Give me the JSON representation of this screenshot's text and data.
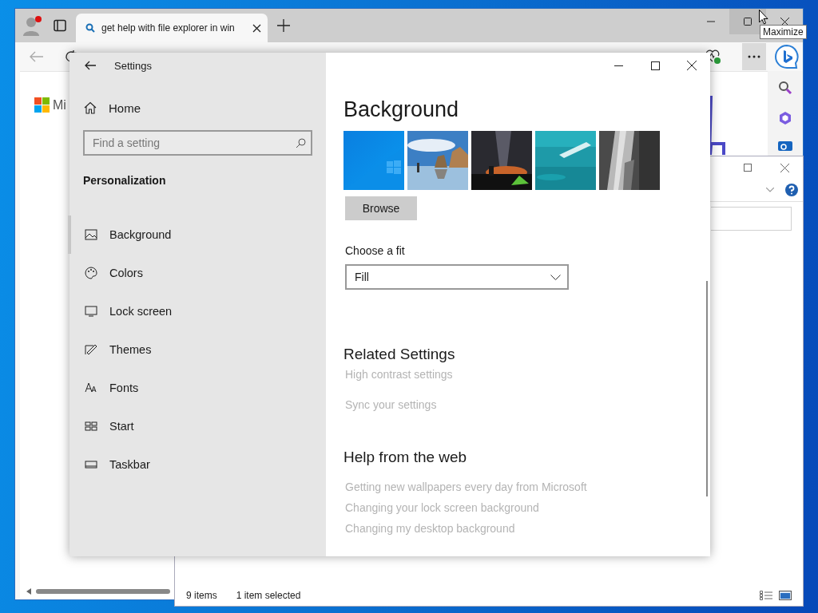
{
  "browser": {
    "tab": {
      "title": "get help with file explorer in win"
    },
    "tooltip": "Maximize",
    "page": {
      "logo_text": "Mi"
    }
  },
  "explorer": {
    "status_bar": {
      "item_count": "9 items",
      "selection": "1 item selected"
    }
  },
  "settings": {
    "title": "Settings",
    "nav": {
      "home": "Home",
      "search_placeholder": "Find a setting",
      "section": "Personalization",
      "items": [
        {
          "label": "Background",
          "selected": true
        },
        {
          "label": "Colors",
          "selected": false
        },
        {
          "label": "Lock screen",
          "selected": false
        },
        {
          "label": "Themes",
          "selected": false
        },
        {
          "label": "Fonts",
          "selected": false
        },
        {
          "label": "Start",
          "selected": false
        },
        {
          "label": "Taskbar",
          "selected": false
        }
      ]
    },
    "page": {
      "heading": "Background",
      "browse_button": "Browse",
      "fit_label": "Choose a fit",
      "fit_value": "Fill",
      "related": {
        "heading": "Related Settings",
        "links": [
          "High contrast settings",
          "Sync your settings"
        ]
      },
      "help": {
        "heading": "Help from the web",
        "links": [
          "Getting new wallpapers every day from Microsoft",
          "Changing your lock screen background",
          "Changing my desktop background"
        ]
      }
    }
  }
}
